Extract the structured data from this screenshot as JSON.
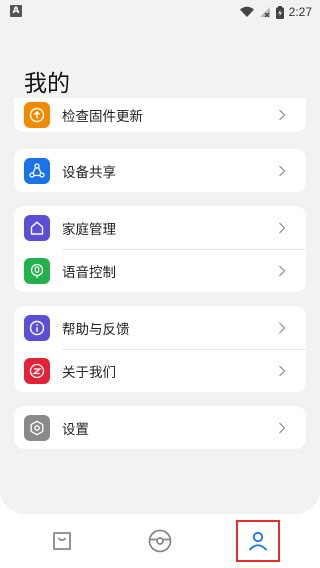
{
  "status_bar": {
    "left_icon": "A",
    "time": "2:27",
    "icons": [
      "wifi-icon",
      "signal-off-icon",
      "battery-charging-icon"
    ]
  },
  "page": {
    "title": "我的"
  },
  "menu": {
    "firmware_update": "检查固件更新",
    "device_share": "设备共享",
    "home_management": "家庭管理",
    "voice_control": "语音控制",
    "help_feedback": "帮助与反馈",
    "about_us": "关于我们",
    "settings": "设置"
  },
  "icons": {
    "firmware_update": {
      "name": "upload-arrow-icon",
      "color": "#f08a00"
    },
    "device_share": {
      "name": "share-network-icon",
      "color": "#1a73e8"
    },
    "home_management": {
      "name": "home-icon",
      "color": "#5b4fd6"
    },
    "voice_control": {
      "name": "microphone-icon",
      "color": "#22b14c"
    },
    "help_feedback": {
      "name": "info-icon",
      "color": "#5b4fd6"
    },
    "about_us": {
      "name": "about-logo-icon",
      "color": "#e0223a"
    },
    "settings": {
      "name": "gear-icon",
      "color": "#8a8a8a"
    }
  },
  "tabbar": {
    "tabs": [
      {
        "name": "bag-icon",
        "active": false
      },
      {
        "name": "device-icon",
        "active": false
      },
      {
        "name": "user-icon",
        "active": true
      }
    ],
    "active_color": "#1a73e8",
    "inactive_color": "#888888"
  }
}
